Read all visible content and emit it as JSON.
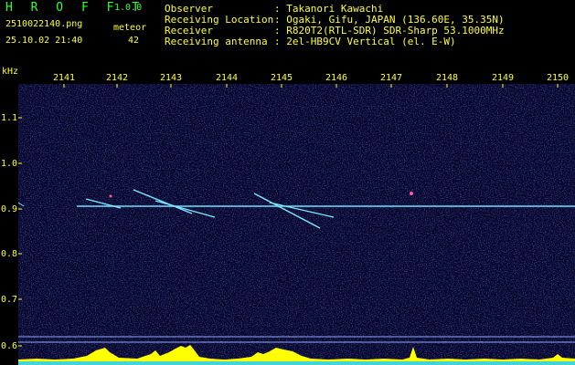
{
  "app": {
    "title": "H R O F F T",
    "version": "1.0.0"
  },
  "file": {
    "name": "2510022140.png",
    "time": "25.10.02 21:40"
  },
  "meteor": {
    "label": "meteor",
    "count": "42"
  },
  "info": [
    {
      "key": "Observer",
      "value": ": Takanori Kawachi"
    },
    {
      "key": "Receiving Location",
      "value": ": Ogaki, Gifu, JAPAN (136.60E, 35.35N)"
    },
    {
      "key": "Receiver",
      "value": ": R820T2(RTL-SDR) SDR-Sharp 53.1000MHz"
    },
    {
      "key": "Receiving antenna",
      "value": ": 2el-HB9CV Vertical (el. E-W)"
    }
  ],
  "spectrogram": {
    "yaxis_label": "kHz",
    "x_ticks": [
      "2141",
      "2142",
      "2143",
      "2144",
      "2145",
      "2146",
      "2147",
      "2148",
      "2149",
      "2150"
    ],
    "y_ticks": [
      "1.1",
      "1.0",
      "0.9",
      "0.8",
      "0.7",
      "0.6"
    ],
    "colors": {
      "background": "#07072c",
      "trace": "#6fe0ff",
      "power": "#ffff00",
      "text_green": "#33ff33",
      "text_yellow": "#ffff33"
    }
  }
}
